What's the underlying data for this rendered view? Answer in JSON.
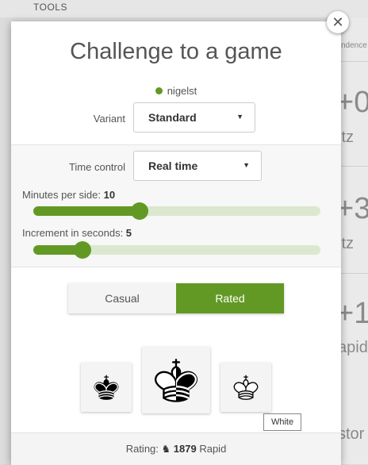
{
  "background": {
    "tools_label": "TOOLS",
    "strip": {
      "top_text": "ndence",
      "row1_big": "+0",
      "row1_small": "itz",
      "row2_big": "+3",
      "row2_small": "itz",
      "row3_big": "+1",
      "row3_small": "apid",
      "row4_small": "stor"
    }
  },
  "modal": {
    "title": "Challenge to a game",
    "opponent": "nigelst",
    "variant": {
      "label": "Variant",
      "value": "Standard"
    },
    "time_control": {
      "label": "Time control",
      "value": "Real time"
    },
    "minutes": {
      "label": "Minutes per side: ",
      "value": "10",
      "fraction": 0.37
    },
    "increment": {
      "label": "Increment in seconds: ",
      "value": "5",
      "fraction": 0.17
    },
    "mode": {
      "casual": "Casual",
      "rated": "Rated",
      "selected": "rated"
    },
    "color_tooltip": "White",
    "rating": {
      "prefix": "Rating: ",
      "value": "1879",
      "suffix": " Rapid"
    }
  },
  "colors": {
    "accent": "#629924",
    "track": "#dbe8cf"
  }
}
